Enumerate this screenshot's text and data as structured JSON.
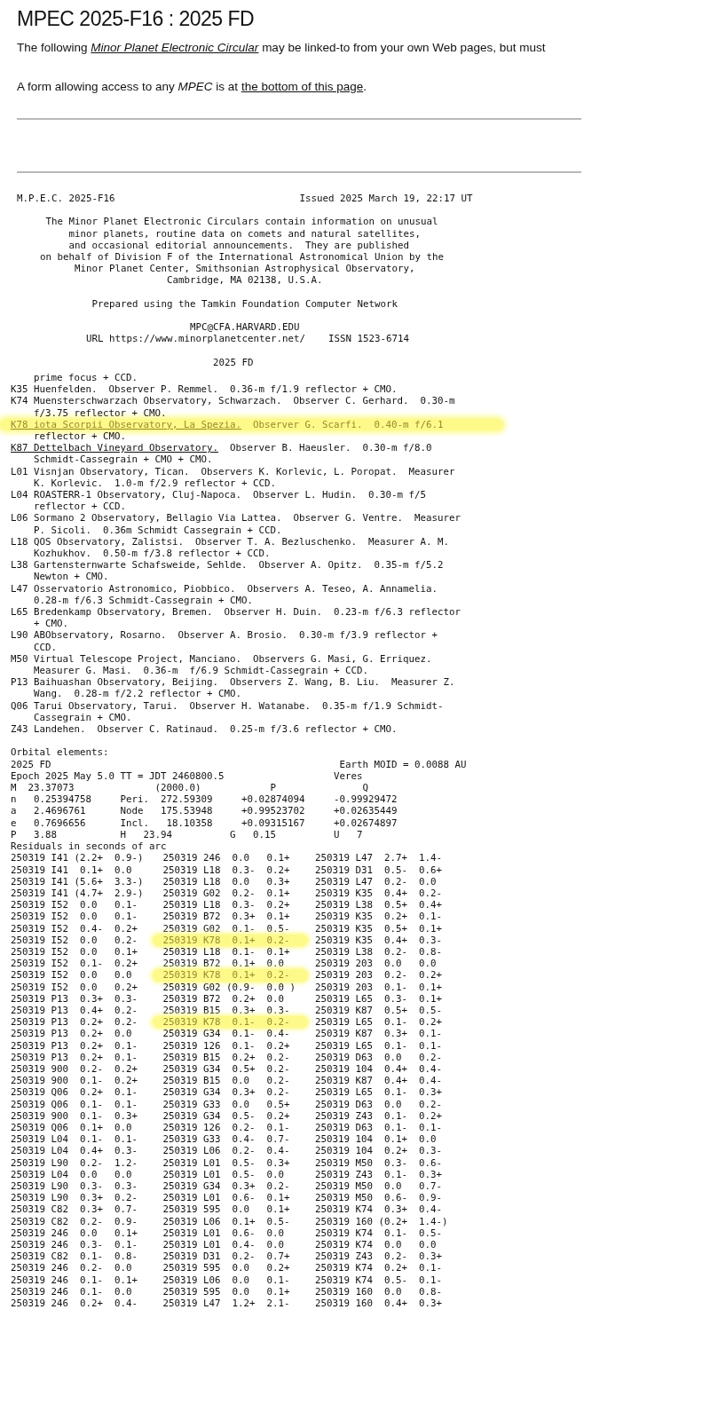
{
  "page": {
    "title": "MPEC 2025-F16 : 2025 FD",
    "intro": {
      "before": "The following ",
      "link": "Minor Planet Electronic Circular",
      "after": " may be linked-to from your own Web pages, but must"
    },
    "form_note": {
      "before": "A form allowing access to any *MPEC* is at ",
      "link": "the bottom of this page",
      "after": "."
    }
  },
  "circular_header": [
    [
      "M.P.E.C. 2025-F16                                Issued 2025 March 19, 22:17 UT"
    ],
    [
      "     The Minor Planet Electronic Circulars contain information on unusual",
      "         minor planets, routine data on comets and natural satellites,",
      "         and occasional editorial announcements.  They are published",
      "    on behalf of Division F of the International Astronomical Union by the",
      "          Minor Planet Center, Smithsonian Astrophysical Observatory,",
      "                          Cambridge, MA 02138, U.S.A."
    ],
    [
      "             Prepared using the Tamkin Foundation Computer Network"
    ],
    [
      "                              MPC@CFA.HARVARD.EDU",
      "            URL https://www.minorplanetcenter.net/    ISSN 1523-6714"
    ],
    [
      "                                  2025 FD"
    ]
  ],
  "observatories": [
    {
      "lines": [
        "    prime focus + CCD."
      ],
      "highlighted": false
    },
    {
      "lines": [
        "K35 Huenfelden.  Observer P. Remmel.  0.36-m f/1.9 reflector + CMO."
      ],
      "highlighted": false
    },
    {
      "lines": [
        "K74 Muensterschwarzach Observatory, Schwarzach.  Observer C. Gerhard.  0.30-m",
        "    f/3.75 reflector + CMO."
      ],
      "highlighted": false
    },
    {
      "link": "K78 iota Scorpii Observatory, La Spezia.",
      "lines": [
        "  Observer G. Scarfi.  0.40-m f/6.1",
        "    reflector + CMO."
      ],
      "highlighted": true
    },
    {
      "link": "K87 Dettelbach Vineyard Observatory.",
      "lines": [
        "  Observer B. Haeusler.  0.30-m f/8.0",
        "    Schmidt-Cassegrain + CMO + CMO."
      ],
      "highlighted": false
    },
    {
      "lines": [
        "L01 Visnjan Observatory, Tican.  Observers K. Korlevic, L. Poropat.  Measurer",
        "    K. Korlevic.  1.0-m f/2.9 reflector + CCD."
      ],
      "highlighted": false
    },
    {
      "lines": [
        "L04 ROASTERR-1 Observatory, Cluj-Napoca.  Observer L. Hudin.  0.30-m f/5",
        "    reflector + CCD."
      ],
      "highlighted": false
    },
    {
      "lines": [
        "L06 Sormano 2 Observatory, Bellagio Via Lattea.  Observer G. Ventre.  Measurer",
        "    P. Sicoli.  0.36m Schmidt Cassegrain + CCD."
      ],
      "highlighted": false
    },
    {
      "lines": [
        "L18 QOS Observatory, Zalistsi.  Observer T. A. Bezluschenko.  Measurer A. M.",
        "    Kozhukhov.  0.50-m f/3.8 reflector + CCD."
      ],
      "highlighted": false
    },
    {
      "lines": [
        "L38 Gartensternwarte Schafsweide, Sehlde.  Observer A. Opitz.  0.35-m f/5.2",
        "    Newton + CMO."
      ],
      "highlighted": false
    },
    {
      "lines": [
        "L47 Osservatorio Astronomico, Piobbico.  Observers A. Teseo, A. Annamelia.",
        "    0.28-m f/6.3 Schmidt-Cassegrain + CMO."
      ],
      "highlighted": false
    },
    {
      "lines": [
        "L65 Bredenkamp Observatory, Bremen.  Observer H. Duin.  0.23-m f/6.3 reflector",
        "    + CMO."
      ],
      "highlighted": false
    },
    {
      "lines": [
        "L90 ABObservatory, Rosarno.  Observer A. Brosio.  0.30-m f/3.9 reflector +",
        "    CCD."
      ],
      "highlighted": false
    },
    {
      "lines": [
        "M50 Virtual Telescope Project, Manciano.  Observers G. Masi, G. Erriquez.",
        "    Measurer G. Masi.  0.36-m  f/6.9 Schmidt-Cassegrain + CCD."
      ],
      "highlighted": false
    },
    {
      "lines": [
        "P13 Baihuashan Observatory, Beijing.  Observers Z. Wang, B. Liu.  Measurer Z.",
        "    Wang.  0.28-m f/2.2 reflector + CMO."
      ],
      "highlighted": false
    },
    {
      "lines": [
        "Q06 Tarui Observatory, Tarui.  Observer H. Watanabe.  0.35-m f/1.9 Schmidt-",
        "    Cassegrain + CMO."
      ],
      "highlighted": false
    },
    {
      "lines": [
        "Z43 Landehen.  Observer C. Ratinaud.  0.25-m f/3.6 reflector + CMO."
      ],
      "highlighted": false
    }
  ],
  "orbital_elements": [
    "Orbital elements:",
    "2025 FD                                                  Earth MOID = 0.0088 AU",
    "Epoch 2025 May 5.0 TT = JDT 2460800.5                   Veres",
    "M  23.37073              (2000.0)            P               Q",
    "n   0.25394758     Peri.  272.59309     +0.02874094     -0.99929472",
    "a   2.4696761      Node   175.53948     +0.99523702     +0.02635449",
    "e   0.7696656      Incl.   18.10358     +0.09315167     +0.02674897",
    "P   3.88           H   23.94          G   0.15          U   7",
    "Residuals in seconds of arc"
  ],
  "residuals": [
    {
      "cells": [
        {
          "text": "250319 I41 (2.2+  0.9-)",
          "highlighted": false
        },
        {
          "text": "250319 246  0.0   0.1+",
          "highlighted": false
        },
        {
          "text": "250319 L47  2.7+  1.4-",
          "highlighted": false
        }
      ]
    },
    {
      "cells": [
        {
          "text": "250319 I41  0.1+  0.0",
          "highlighted": false
        },
        {
          "text": "250319 L18  0.3-  0.2+",
          "highlighted": false
        },
        {
          "text": "250319 D31  0.5-  0.6+",
          "highlighted": false
        }
      ]
    },
    {
      "cells": [
        {
          "text": "250319 I41 (5.6+  3.3-)",
          "highlighted": false
        },
        {
          "text": "250319 L18  0.0   0.3+",
          "highlighted": false
        },
        {
          "text": "250319 L47  0.2-  0.0",
          "highlighted": false
        }
      ]
    },
    {
      "cells": [
        {
          "text": "250319 I41 (4.7+  2.9-)",
          "highlighted": false
        },
        {
          "text": "250319 G02  0.2-  0.1+",
          "highlighted": false
        },
        {
          "text": "250319 K35  0.4+  0.2-",
          "highlighted": false
        }
      ]
    },
    {
      "cells": [
        {
          "text": "250319 I52  0.0   0.1-",
          "highlighted": false
        },
        {
          "text": "250319 L18  0.3-  0.2+",
          "highlighted": false
        },
        {
          "text": "250319 L38  0.5+  0.4+",
          "highlighted": false
        }
      ]
    },
    {
      "cells": [
        {
          "text": "250319 I52  0.0   0.1-",
          "highlighted": false
        },
        {
          "text": "250319 B72  0.3+  0.1+",
          "highlighted": false
        },
        {
          "text": "250319 K35  0.2+  0.1-",
          "highlighted": false
        }
      ]
    },
    {
      "cells": [
        {
          "text": "250319 I52  0.4-  0.2+",
          "highlighted": false
        },
        {
          "text": "250319 G02  0.1-  0.5-",
          "highlighted": false
        },
        {
          "text": "250319 K35  0.5+  0.1+",
          "highlighted": false
        }
      ]
    },
    {
      "cells": [
        {
          "text": "250319 I52  0.0   0.2-",
          "highlighted": false
        },
        {
          "text": "250319 K78  0.1+  0.2-",
          "highlighted": true
        },
        {
          "text": "250319 K35  0.4+  0.3-",
          "highlighted": false
        }
      ]
    },
    {
      "cells": [
        {
          "text": "250319 I52  0.0   0.1+",
          "highlighted": false
        },
        {
          "text": "250319 L18  0.1-  0.1+",
          "highlighted": false
        },
        {
          "text": "250319 L38  0.2-  0.8-",
          "highlighted": false
        }
      ]
    },
    {
      "cells": [
        {
          "text": "250319 I52  0.1-  0.2+",
          "highlighted": false
        },
        {
          "text": "250319 B72  0.1+  0.0",
          "highlighted": false
        },
        {
          "text": "250319 203  0.0   0.0",
          "highlighted": false
        }
      ]
    },
    {
      "cells": [
        {
          "text": "250319 I52  0.0   0.0",
          "highlighted": false
        },
        {
          "text": "250319 K78  0.1+  0.2-",
          "highlighted": true
        },
        {
          "text": "250319 203  0.2-  0.2+",
          "highlighted": false
        }
      ]
    },
    {
      "cells": [
        {
          "text": "250319 I52  0.0   0.2+",
          "highlighted": false
        },
        {
          "text": "250319 G02 (0.9-  0.0 )",
          "highlighted": false
        },
        {
          "text": "250319 203  0.1-  0.1+",
          "highlighted": false
        }
      ]
    },
    {
      "cells": [
        {
          "text": "250319 P13  0.3+  0.3-",
          "highlighted": false
        },
        {
          "text": "250319 B72  0.2+  0.0",
          "highlighted": false
        },
        {
          "text": "250319 L65  0.3-  0.1+",
          "highlighted": false
        }
      ]
    },
    {
      "cells": [
        {
          "text": "250319 P13  0.4+  0.2-",
          "highlighted": false
        },
        {
          "text": "250319 B15  0.3+  0.3-",
          "highlighted": false
        },
        {
          "text": "250319 K87  0.5+  0.5-",
          "highlighted": false
        }
      ]
    },
    {
      "cells": [
        {
          "text": "250319 P13  0.2+  0.2-",
          "highlighted": false
        },
        {
          "text": "250319 K78  0.1-  0.2-",
          "highlighted": true
        },
        {
          "text": "250319 L65  0.1-  0.2+",
          "highlighted": false
        }
      ]
    },
    {
      "cells": [
        {
          "text": "250319 P13  0.2+  0.0",
          "highlighted": false
        },
        {
          "text": "250319 G34  0.1-  0.4-",
          "highlighted": false
        },
        {
          "text": "250319 K87  0.3+  0.1-",
          "highlighted": false
        }
      ]
    },
    {
      "cells": [
        {
          "text": "250319 P13  0.2+  0.1-",
          "highlighted": false
        },
        {
          "text": "250319 126  0.1-  0.2+",
          "highlighted": false
        },
        {
          "text": "250319 L65  0.1-  0.1-",
          "highlighted": false
        }
      ]
    },
    {
      "cells": [
        {
          "text": "250319 P13  0.2+  0.1-",
          "highlighted": false
        },
        {
          "text": "250319 B15  0.2+  0.2-",
          "highlighted": false
        },
        {
          "text": "250319 D63  0.0   0.2-",
          "highlighted": false
        }
      ]
    },
    {
      "cells": [
        {
          "text": "250319 900  0.2-  0.2+",
          "highlighted": false
        },
        {
          "text": "250319 G34  0.5+  0.2-",
          "highlighted": false
        },
        {
          "text": "250319 104  0.4+  0.4-",
          "highlighted": false
        }
      ]
    },
    {
      "cells": [
        {
          "text": "250319 900  0.1-  0.2+",
          "highlighted": false
        },
        {
          "text": "250319 B15  0.0   0.2-",
          "highlighted": false
        },
        {
          "text": "250319 K87  0.4+  0.4-",
          "highlighted": false
        }
      ]
    },
    {
      "cells": [
        {
          "text": "250319 Q06  0.2+  0.1-",
          "highlighted": false
        },
        {
          "text": "250319 G34  0.3+  0.2-",
          "highlighted": false
        },
        {
          "text": "250319 L65  0.1-  0.3+",
          "highlighted": false
        }
      ]
    },
    {
      "cells": [
        {
          "text": "250319 Q06  0.1-  0.1-",
          "highlighted": false
        },
        {
          "text": "250319 G33  0.0   0.5+",
          "highlighted": false
        },
        {
          "text": "250319 D63  0.0   0.2-",
          "highlighted": false
        }
      ]
    },
    {
      "cells": [
        {
          "text": "250319 900  0.1-  0.3+",
          "highlighted": false
        },
        {
          "text": "250319 G34  0.5-  0.2+",
          "highlighted": false
        },
        {
          "text": "250319 Z43  0.1-  0.2+",
          "highlighted": false
        }
      ]
    },
    {
      "cells": [
        {
          "text": "250319 Q06  0.1+  0.0",
          "highlighted": false
        },
        {
          "text": "250319 126  0.2-  0.1-",
          "highlighted": false
        },
        {
          "text": "250319 D63  0.1-  0.1-",
          "highlighted": false
        }
      ]
    },
    {
      "cells": [
        {
          "text": "250319 L04  0.1-  0.1-",
          "highlighted": false
        },
        {
          "text": "250319 G33  0.4-  0.7-",
          "highlighted": false
        },
        {
          "text": "250319 104  0.1+  0.0",
          "highlighted": false
        }
      ]
    },
    {
      "cells": [
        {
          "text": "250319 L04  0.4+  0.3-",
          "highlighted": false
        },
        {
          "text": "250319 L06  0.2-  0.4-",
          "highlighted": false
        },
        {
          "text": "250319 104  0.2+  0.3-",
          "highlighted": false
        }
      ]
    },
    {
      "cells": [
        {
          "text": "250319 L90  0.2-  1.2-",
          "highlighted": false
        },
        {
          "text": "250319 L01  0.5-  0.3+",
          "highlighted": false
        },
        {
          "text": "250319 M50  0.3-  0.6-",
          "highlighted": false
        }
      ]
    },
    {
      "cells": [
        {
          "text": "250319 L04  0.0   0.0",
          "highlighted": false
        },
        {
          "text": "250319 L01  0.5-  0.0",
          "highlighted": false
        },
        {
          "text": "250319 Z43  0.1-  0.3+",
          "highlighted": false
        }
      ]
    },
    {
      "cells": [
        {
          "text": "250319 L90  0.3-  0.3-",
          "highlighted": false
        },
        {
          "text": "250319 G34  0.3+  0.2-",
          "highlighted": false
        },
        {
          "text": "250319 M50  0.0   0.7-",
          "highlighted": false
        }
      ]
    },
    {
      "cells": [
        {
          "text": "250319 L90  0.3+  0.2-",
          "highlighted": false
        },
        {
          "text": "250319 L01  0.6-  0.1+",
          "highlighted": false
        },
        {
          "text": "250319 M50  0.6-  0.9-",
          "highlighted": false
        }
      ]
    },
    {
      "cells": [
        {
          "text": "250319 C82  0.3+  0.7-",
          "highlighted": false
        },
        {
          "text": "250319 595  0.0   0.1+",
          "highlighted": false
        },
        {
          "text": "250319 K74  0.3+  0.4-",
          "highlighted": false
        }
      ]
    },
    {
      "cells": [
        {
          "text": "250319 C82  0.2-  0.9-",
          "highlighted": false
        },
        {
          "text": "250319 L06  0.1+  0.5-",
          "highlighted": false
        },
        {
          "text": "250319 160 (0.2+  1.4-)",
          "highlighted": false
        }
      ]
    },
    {
      "cells": [
        {
          "text": "250319 246  0.0   0.1+",
          "highlighted": false
        },
        {
          "text": "250319 L01  0.6-  0.0",
          "highlighted": false
        },
        {
          "text": "250319 K74  0.1-  0.5-",
          "highlighted": false
        }
      ]
    },
    {
      "cells": [
        {
          "text": "250319 246  0.3-  0.1-",
          "highlighted": false
        },
        {
          "text": "250319 L01  0.4-  0.0",
          "highlighted": false
        },
        {
          "text": "250319 K74  0.0   0.0",
          "highlighted": false
        }
      ]
    },
    {
      "cells": [
        {
          "text": "250319 C82  0.1-  0.8-",
          "highlighted": false
        },
        {
          "text": "250319 D31  0.2-  0.7+",
          "highlighted": false
        },
        {
          "text": "250319 Z43  0.2-  0.3+",
          "highlighted": false
        }
      ]
    },
    {
      "cells": [
        {
          "text": "250319 246  0.2-  0.0",
          "highlighted": false
        },
        {
          "text": "250319 595  0.0   0.2+",
          "highlighted": false
        },
        {
          "text": "250319 K74  0.2+  0.1-",
          "highlighted": false
        }
      ]
    },
    {
      "cells": [
        {
          "text": "250319 246  0.1-  0.1+",
          "highlighted": false
        },
        {
          "text": "250319 L06  0.0   0.1-",
          "highlighted": false
        },
        {
          "text": "250319 K74  0.5-  0.1-",
          "highlighted": false
        }
      ]
    },
    {
      "cells": [
        {
          "text": "250319 246  0.1-  0.0",
          "highlighted": false
        },
        {
          "text": "250319 595  0.0   0.1+",
          "highlighted": false
        },
        {
          "text": "250319 160  0.0   0.8-",
          "highlighted": false
        }
      ]
    },
    {
      "cells": [
        {
          "text": "250319 246  0.2+  0.4-",
          "highlighted": false
        },
        {
          "text": "250319 L47  1.2+  2.1-",
          "highlighted": false
        },
        {
          "text": "250319 160  0.4+  0.3+",
          "highlighted": false
        }
      ]
    }
  ]
}
